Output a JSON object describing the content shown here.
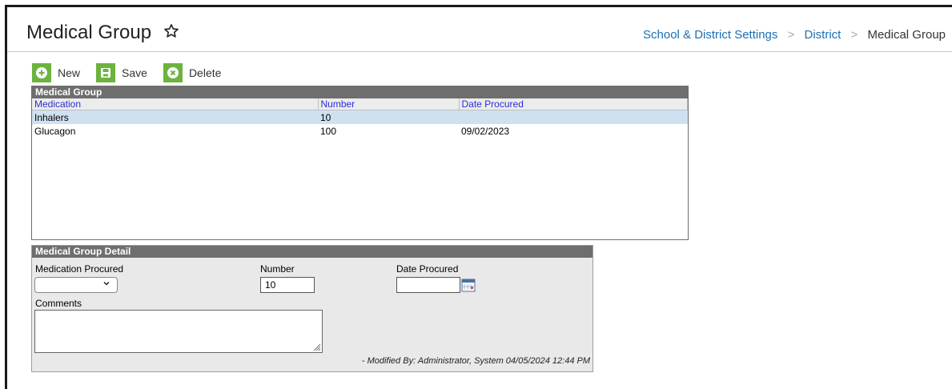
{
  "header": {
    "title": "Medical Group",
    "breadcrumb": [
      "School & District Settings",
      "District",
      "Medical Group"
    ]
  },
  "toolbar": {
    "new_label": "New",
    "save_label": "Save",
    "delete_label": "Delete"
  },
  "grid": {
    "title": "Medical Group",
    "columns": [
      "Medication",
      "Number",
      "Date Procured"
    ],
    "rows": [
      {
        "medication": "Inhalers",
        "number": "10",
        "date": "",
        "selected": true
      },
      {
        "medication": "Glucagon",
        "number": "100",
        "date": "09/02/2023",
        "selected": false
      }
    ]
  },
  "detail": {
    "title": "Medical Group Detail",
    "medication_label": "Medication Procured",
    "medication_value": "",
    "number_label": "Number",
    "number_value": "10",
    "date_label": "Date Procured",
    "date_value": "",
    "comments_label": "Comments",
    "comments_value": "",
    "modified": "- Modified By: Administrator, System 04/05/2024 12:44 PM"
  },
  "colors": {
    "accent_green": "#6cb33f",
    "link_blue": "#1b6fb5",
    "header_gray": "#6e6e6e",
    "selected_row": "#cfe0f1"
  },
  "icons": [
    "star-icon",
    "plus-icon",
    "save-icon",
    "delete-icon",
    "chevron-down-icon",
    "calendar-icon",
    "resize-icon"
  ]
}
